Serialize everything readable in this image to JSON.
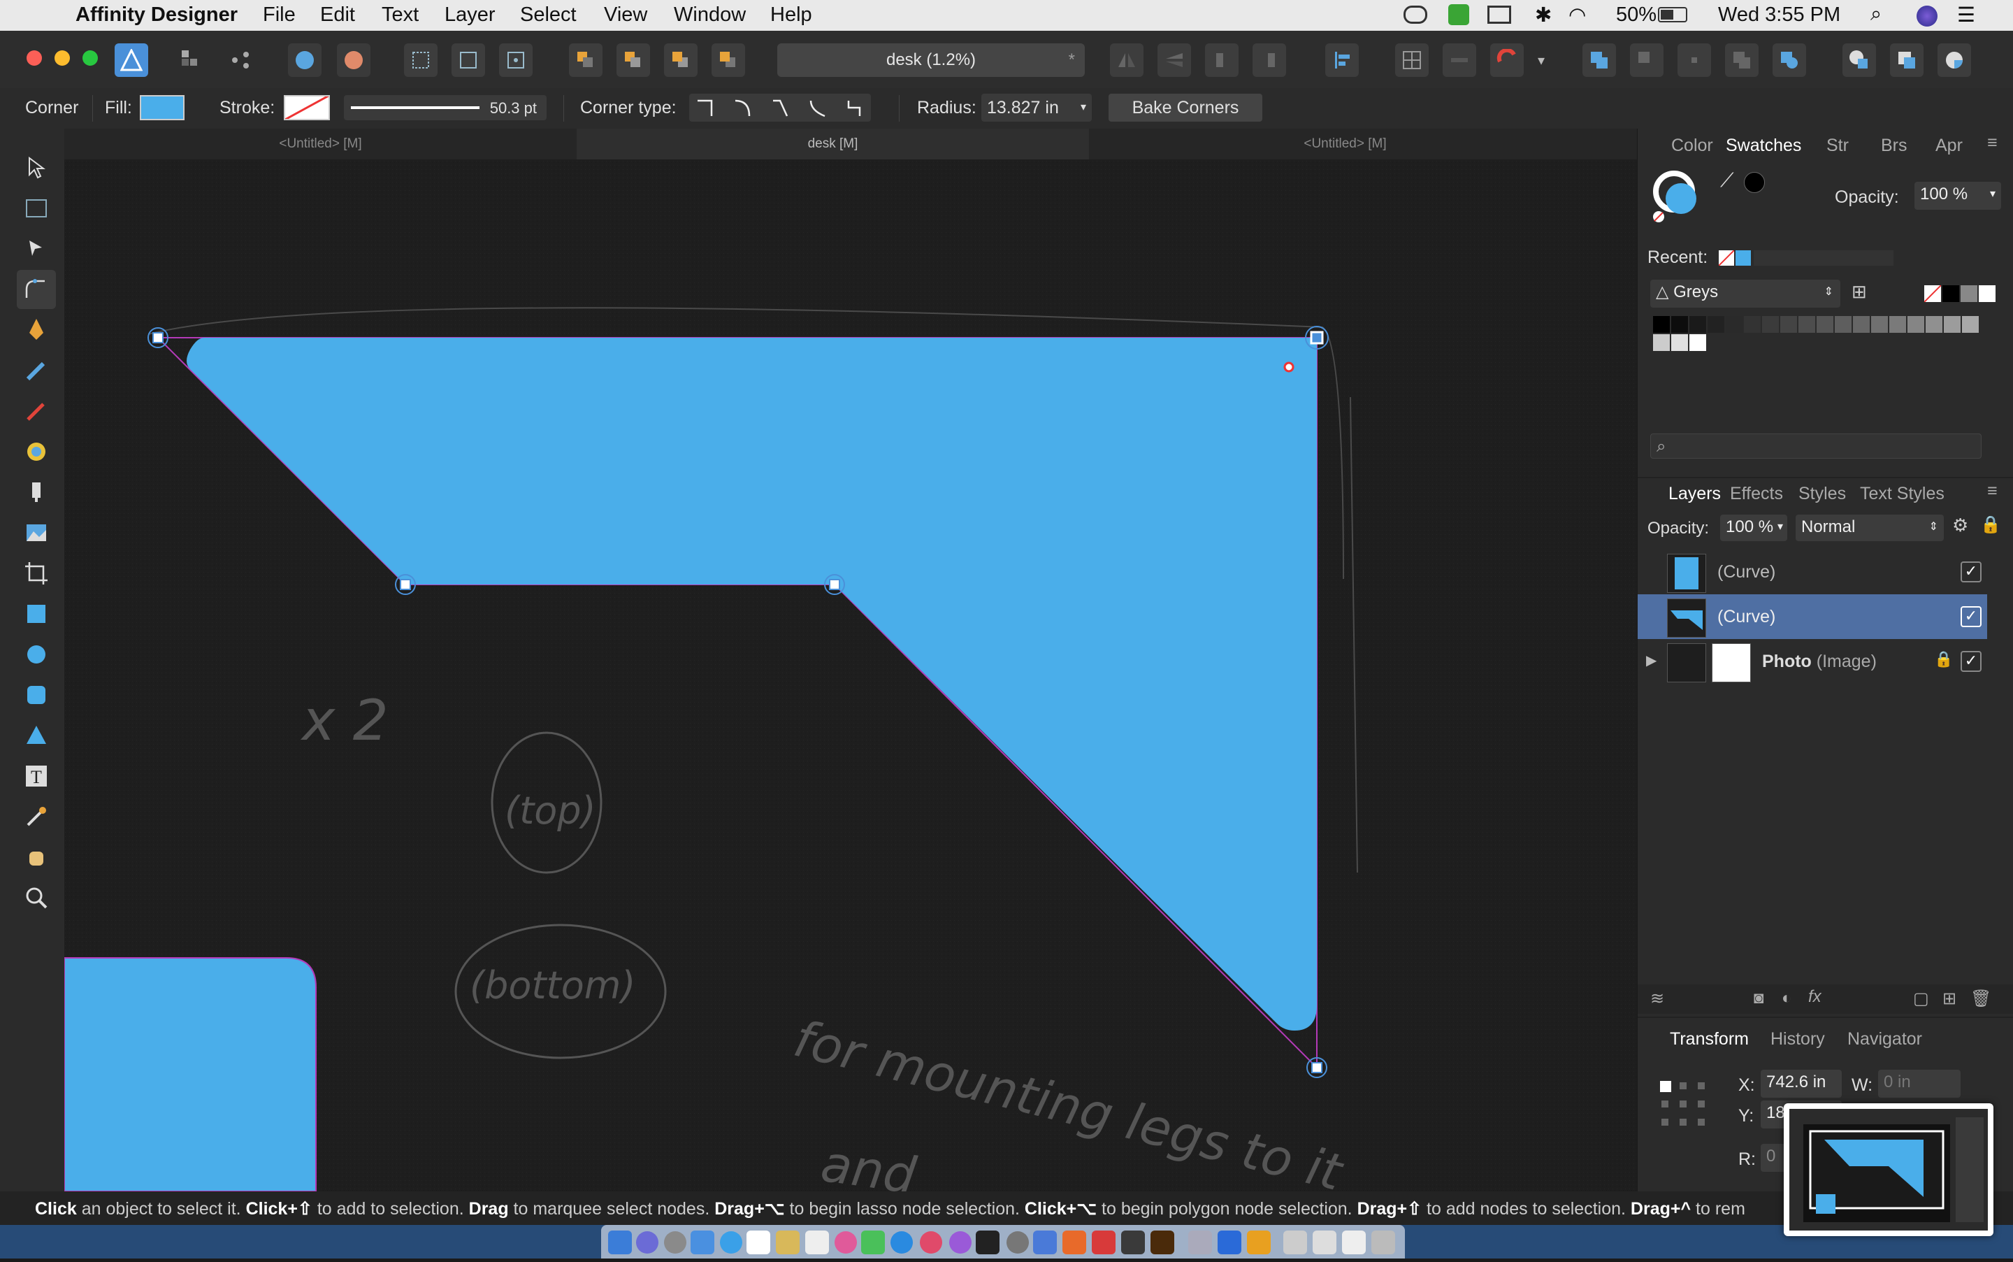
{
  "menubar": {
    "app_name": "Affinity Designer",
    "items": [
      "File",
      "Edit",
      "Text",
      "Layer",
      "Select",
      "View",
      "Window",
      "Help"
    ],
    "battery": "50%",
    "clock": "Wed 3:55 PM"
  },
  "toolbar": {
    "document_title": "desk (1.2%)",
    "modified_mark": "*"
  },
  "context": {
    "tool_name": "Corner",
    "fill_label": "Fill:",
    "stroke_label": "Stroke:",
    "stroke_width": "50.3 pt",
    "corner_type_label": "Corner type:",
    "radius_label": "Radius:",
    "radius_value": "13.827 in",
    "bake_button": "Bake Corners"
  },
  "tabs": [
    "<Untitled> [M]",
    "desk [M]",
    "<Untitled> [M]"
  ],
  "active_tab": 1,
  "swatches_panel": {
    "tabs": [
      "Color",
      "Swatches",
      "Str",
      "Brs",
      "Apr"
    ],
    "active": "Swatches",
    "opacity_label": "Opacity:",
    "opacity_value": "100 %",
    "recent_label": "Recent:",
    "palette": "Greys"
  },
  "layers_panel": {
    "tabs": [
      "Layers",
      "Effects",
      "Styles",
      "Text Styles"
    ],
    "active": "Layers",
    "opacity_label": "Opacity:",
    "opacity_value": "100 %",
    "blend_mode": "Normal",
    "layers": [
      {
        "name": "(Curve)",
        "kind": "",
        "selected": false
      },
      {
        "name": "(Curve)",
        "kind": "",
        "selected": true
      },
      {
        "name": "Photo",
        "kind": "(Image)",
        "selected": false
      }
    ]
  },
  "transform_panel": {
    "tabs": [
      "Transform",
      "History",
      "Navigator"
    ],
    "active": "Transform",
    "x_label": "X:",
    "x_value": "742.6 in",
    "y_label": "Y:",
    "y_value": "18",
    "w_label": "W:",
    "w_placeholder": "0 in",
    "r_label": "R:",
    "r_value": "0"
  },
  "status": {
    "parts": [
      {
        "b": "Click"
      },
      {
        "t": " an object to select it. "
      },
      {
        "b": "Click+⇧"
      },
      {
        "t": " to add to selection. "
      },
      {
        "b": "Drag"
      },
      {
        "t": " to marquee select nodes. "
      },
      {
        "b": "Drag+⌥"
      },
      {
        "t": " to begin lasso node selection. "
      },
      {
        "b": "Click+⌥"
      },
      {
        "t": " to begin polygon node selection. "
      },
      {
        "b": "Drag+⇧"
      },
      {
        "t": " to add nodes to selection. "
      },
      {
        "b": "Drag+^"
      },
      {
        "t": " to rem"
      }
    ]
  },
  "sketch_notes": [
    "x 2",
    "(top)",
    "(bottom)",
    "for mounting legs to it",
    "and"
  ],
  "colors": {
    "accent_fill": "#4aaeea",
    "selection_row": "#4f6fa3",
    "curve_outline": "#b43ab8"
  }
}
